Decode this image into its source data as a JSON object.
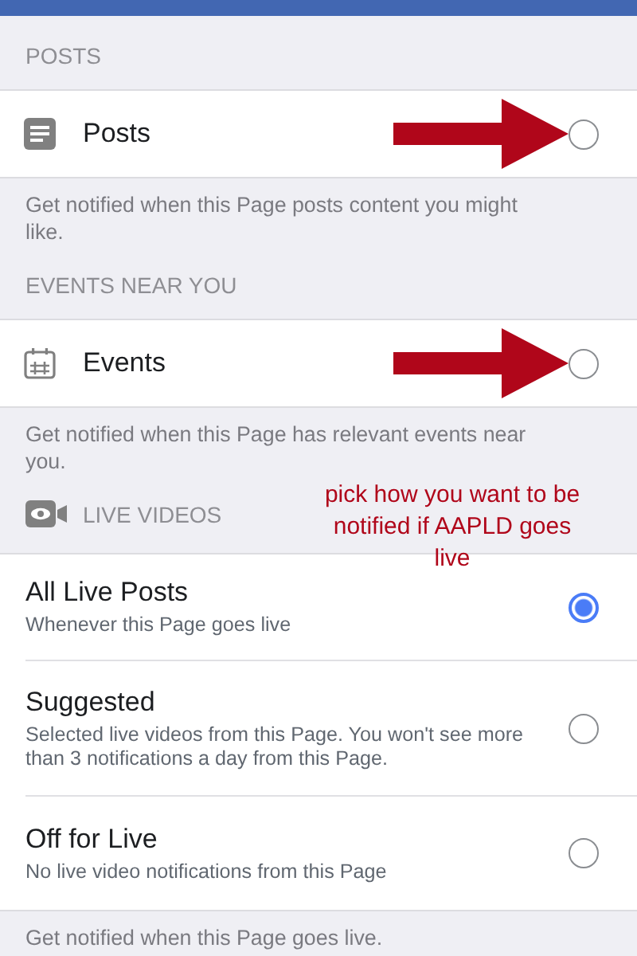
{
  "posts_section": {
    "heading": "POSTS",
    "option": {
      "label": "Posts",
      "selected": false,
      "arrow": true
    },
    "description": "Get notified when this Page posts content you might like."
  },
  "events_section": {
    "heading": "EVENTS NEAR YOU",
    "option": {
      "label": "Events",
      "selected": false,
      "arrow": true
    },
    "description": "Get notified when this Page has relevant events near you."
  },
  "live_section": {
    "heading": "LIVE VIDEOS",
    "options": [
      {
        "label": "All Live Posts",
        "detail": "Whenever this Page goes live",
        "selected": true
      },
      {
        "label": "Suggested",
        "detail": "Selected live videos from this Page. You won't see more than 3 notifications a day from this Page.",
        "selected": false
      },
      {
        "label": "Off for Live",
        "detail": "No live video notifications from this Page",
        "selected": false
      }
    ],
    "description": "Get notified when this Page goes live."
  },
  "annotation": {
    "text": "pick how you want to be notified if AAPLD goes live"
  }
}
